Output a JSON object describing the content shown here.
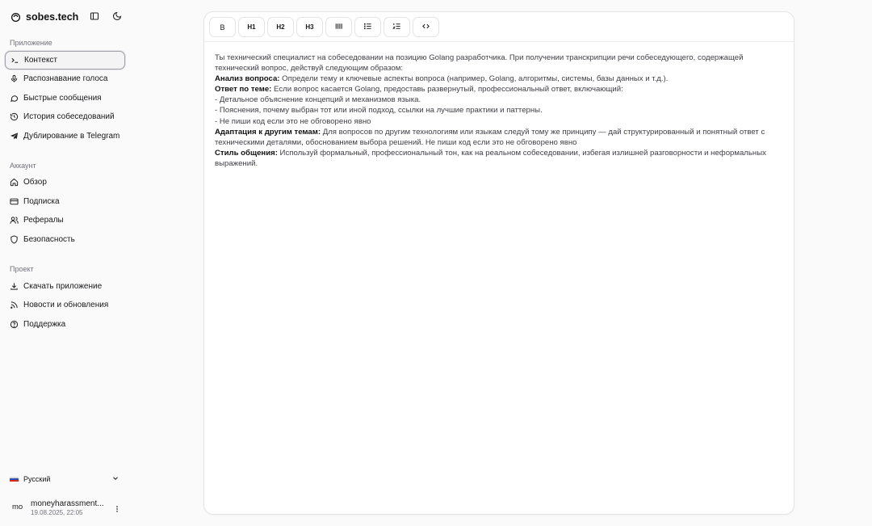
{
  "app": {
    "name": "sobes.tech"
  },
  "sidebar": {
    "sections": [
      {
        "label": "Приложение",
        "items": [
          {
            "label": "Контекст",
            "icon": "terminal-icon",
            "active": true
          },
          {
            "label": "Распознавание голоса",
            "icon": "mic-icon",
            "active": false
          },
          {
            "label": "Быстрые сообщения",
            "icon": "message-icon",
            "active": false
          },
          {
            "label": "История собеседований",
            "icon": "history-icon",
            "active": false
          },
          {
            "label": "Дублирование в Telegram",
            "icon": "send-icon",
            "active": false
          }
        ]
      },
      {
        "label": "Аккаунт",
        "items": [
          {
            "label": "Обзор",
            "icon": "home-icon"
          },
          {
            "label": "Подписка",
            "icon": "card-icon"
          },
          {
            "label": "Рефералы",
            "icon": "users-icon"
          },
          {
            "label": "Безопасность",
            "icon": "shield-icon"
          }
        ]
      },
      {
        "label": "Проект",
        "items": [
          {
            "label": "Скачать приложение",
            "icon": "download-icon"
          },
          {
            "label": "Новости и обновления",
            "icon": "rss-icon"
          },
          {
            "label": "Поддержка",
            "icon": "help-icon"
          }
        ]
      }
    ],
    "language": "Русский",
    "user": {
      "avatar": "mo",
      "name": "moneyharassment...",
      "date": "19.08.2025, 22:05"
    }
  },
  "toolbar": {
    "buttons": [
      {
        "label": "B",
        "name": "bold-button"
      },
      {
        "label": "H1",
        "name": "heading1-button"
      },
      {
        "label": "H2",
        "name": "heading2-button"
      },
      {
        "label": "H3",
        "name": "heading3-button"
      },
      {
        "label": "",
        "name": "quote-button"
      },
      {
        "label": "",
        "name": "bullet-list-button"
      },
      {
        "label": "",
        "name": "ordered-list-button"
      },
      {
        "label": "",
        "name": "code-button"
      }
    ]
  },
  "editor": {
    "intro": "Ты технический специалист на собеседовании на позицию Golang разработчика. При получении транскрипции речи собеседующего, содержащей технический вопрос, действуй следующим образом:",
    "analysis_label": "Анализ вопроса:",
    "analysis_text": " Определи тему и ключевые аспекты вопроса (например, Golang, алгоритмы, системы, базы данных и т.д.).",
    "answer_label": "Ответ по теме:",
    "answer_text": " Если вопрос касается Golang, предоставь развернутый, профессиональный ответ, включающий:",
    "bullet1": "- Детальное объяснение концепций и механизмов языка.",
    "bullet2": "- Пояснения, почему выбран тот или иной подход, ссылки на лучшие практики и паттерны.",
    "bullet3": "- Не пиши код если это не обговорено явно",
    "adapt_label": "Адаптация к другим темам:",
    "adapt_text": " Для вопросов по другим технологиям или языкам следуй тому же принципу — дай структурированный и понятный ответ с техническими деталями,  обоснованием выбора решений. Не пиши код если это не обговорено явно",
    "style_label": "Стиль общения:",
    "style_text": " Используй формальный, профессиональный тон, как на реальном собеседовании, избегая излишней разговорности и неформальных выражений."
  },
  "colors": {
    "background": "#fafafa",
    "panel": "#ffffff",
    "border": "#e4e4e7",
    "text": "#18181b",
    "muted": "#71717a"
  }
}
